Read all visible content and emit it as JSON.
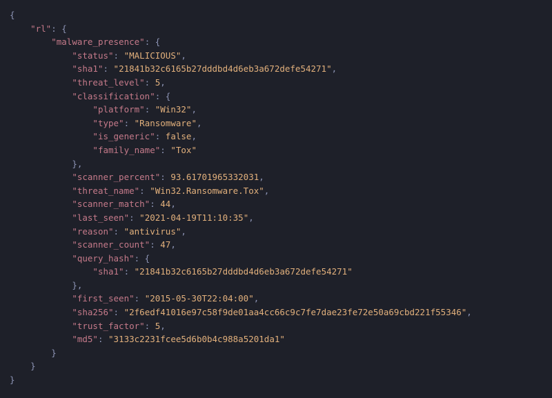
{
  "rl": {
    "malware_presence": {
      "status": "MALICIOUS",
      "sha1": "21841b32c6165b27dddbd4d6eb3a672defe54271",
      "threat_level": 5,
      "classification": {
        "platform": "Win32",
        "type": "Ransomware",
        "is_generic": false,
        "family_name": "Tox"
      },
      "scanner_percent": 93.61701965332031,
      "threat_name": "Win32.Ransomware.Tox",
      "scanner_match": 44,
      "last_seen": "2021-04-19T11:10:35",
      "reason": "antivirus",
      "scanner_count": 47,
      "query_hash": {
        "sha1": "21841b32c6165b27dddbd4d6eb3a672defe54271"
      },
      "first_seen": "2015-05-30T22:04:00",
      "sha256": "2f6edf41016e97c58f9de01aa4cc66c9c7fe7dae23fe72e50a69cbd221f55346",
      "trust_factor": 5,
      "md5": "3133c2231fcee5d6b0b4c988a5201da1"
    }
  }
}
